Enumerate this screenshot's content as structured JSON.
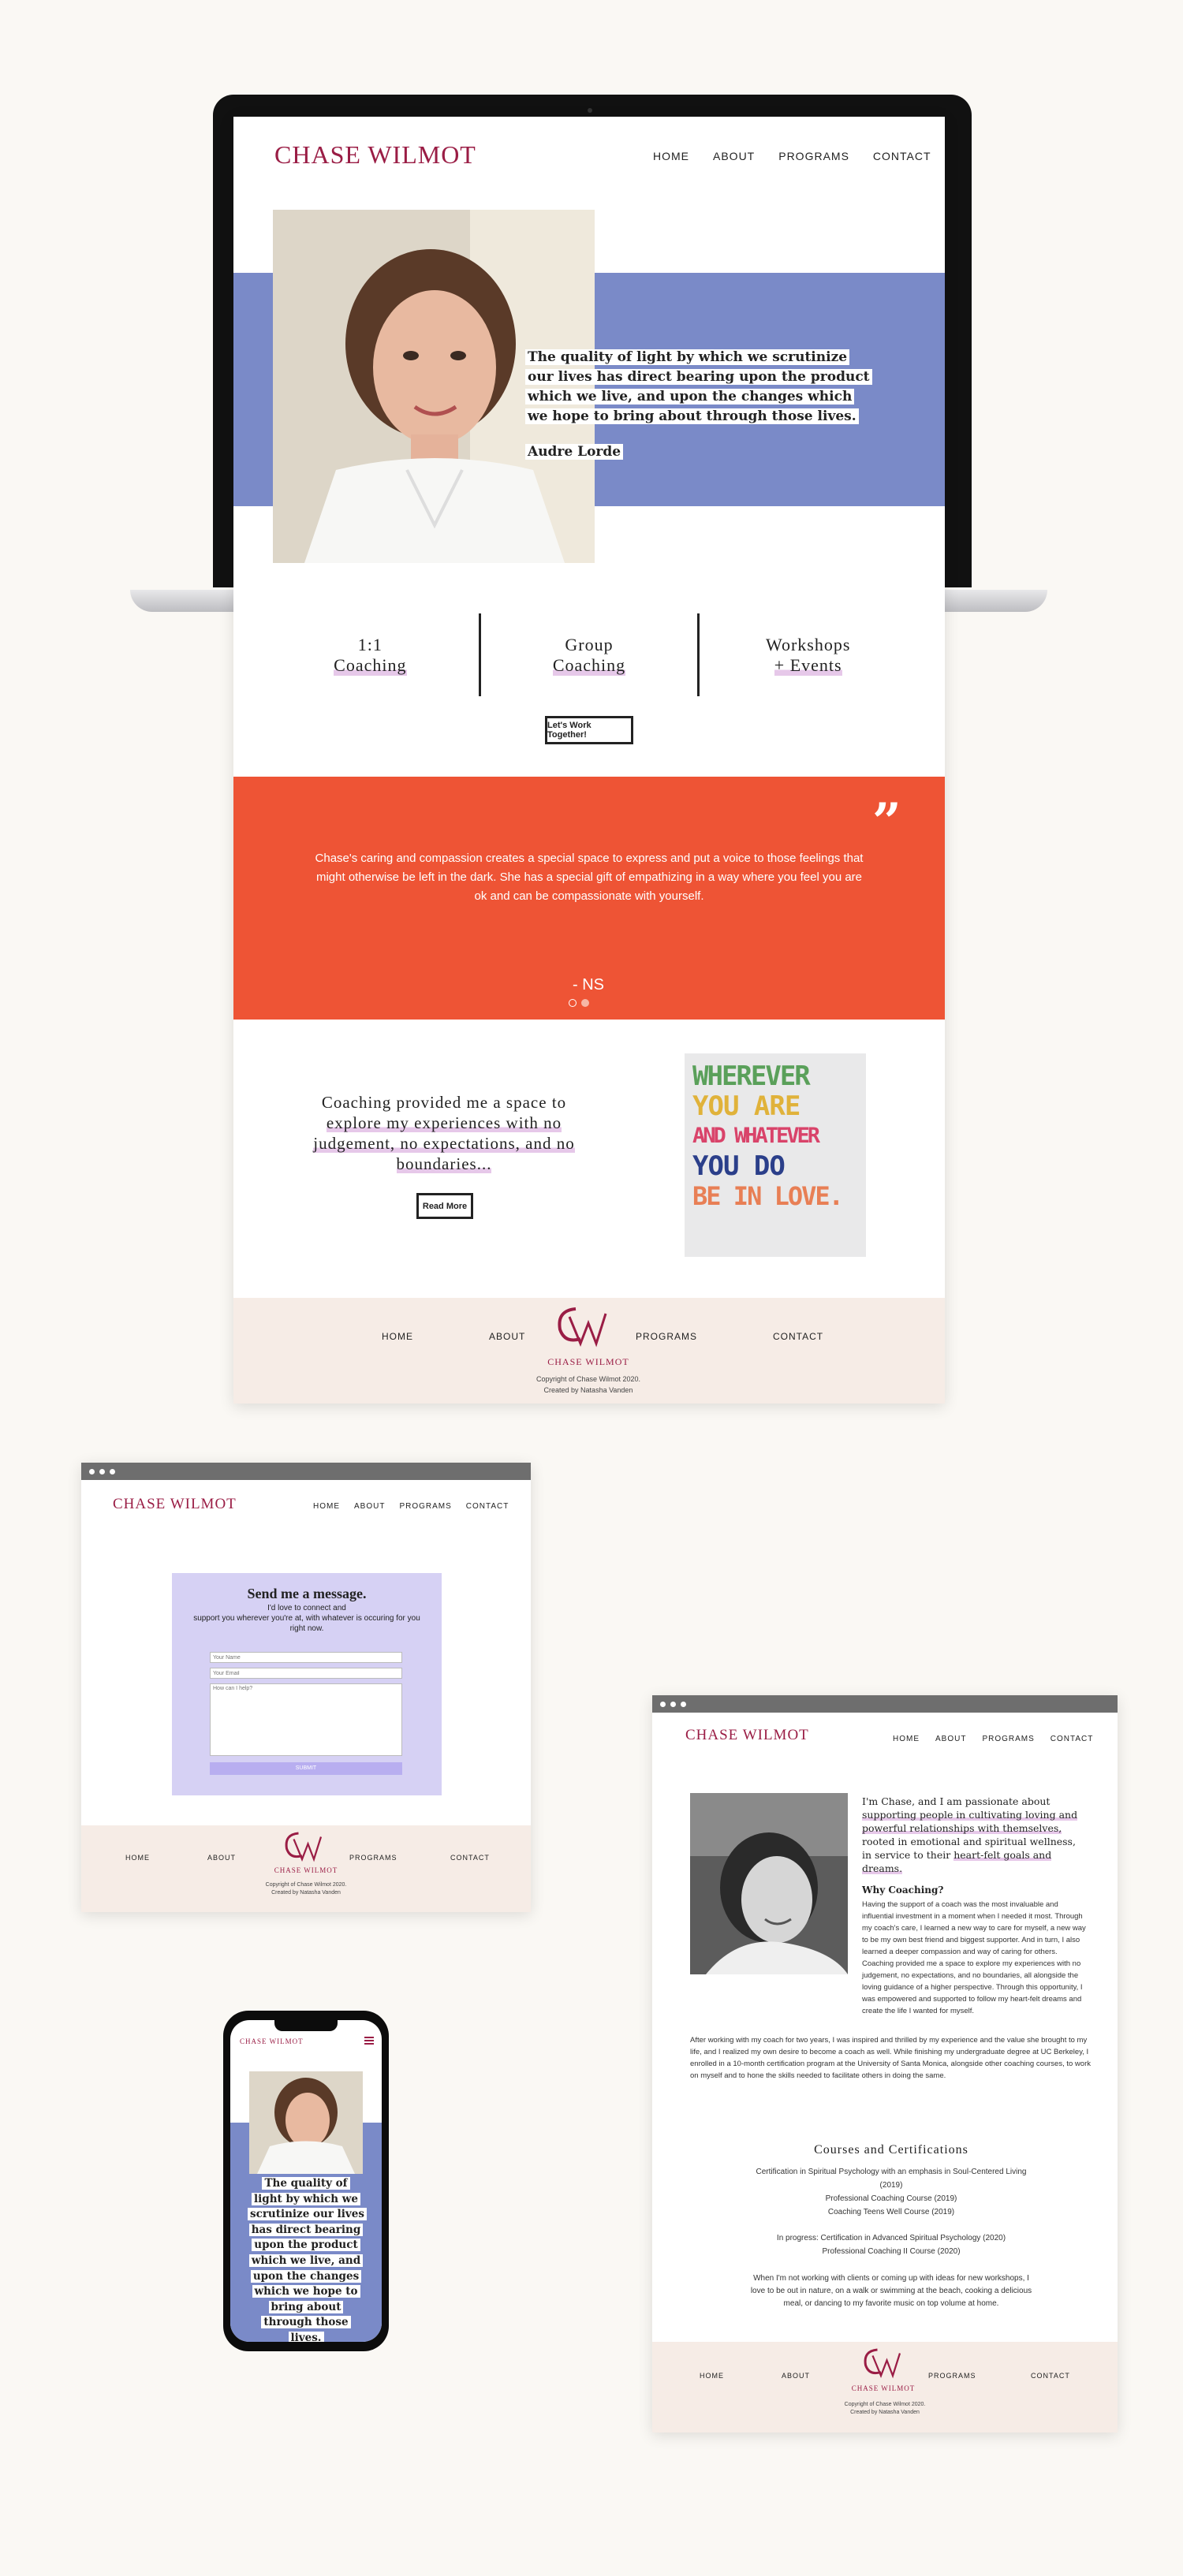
{
  "brand": "CHASE WILMOT",
  "colors": {
    "wine": "#9a1d45",
    "periwinkle": "#7a8ac8",
    "coral": "#ee5435",
    "footer": "#f6ece6",
    "lavender": "#d6d1f4"
  },
  "nav": [
    "HOME",
    "ABOUT",
    "PROGRAMS",
    "CONTACT"
  ],
  "hero": {
    "quote": "The quality of light by which we scrutinize our lives has direct bearing upon the product which we live, and upon the changes which we hope to bring about through those lives.",
    "author": "Audre Lorde"
  },
  "services": [
    {
      "line1": "1:1",
      "line2": "Coaching"
    },
    {
      "line1": "Group",
      "line2": "Coaching"
    },
    {
      "line1": "Workshops",
      "line2": "+ Events"
    }
  ],
  "cta": "Let's Work Together!",
  "testimonial": {
    "text": "Chase's caring and compassion creates a special space to express and put a voice to those feelings that might otherwise be left in the dark. She has a special gift of empathizing in a way where you feel you are ok and can be compassionate with yourself.",
    "attribution": "- NS"
  },
  "coaching_blurb": {
    "line1": "Coaching provided me a space to",
    "line2": "explore my experiences with no",
    "line3": "judgement, no expectations, and no",
    "line4": "boundaries...",
    "button": "Read More"
  },
  "poster": {
    "lines": [
      "WHEREVER",
      "YOU ARE",
      "AND WHATEVER",
      "YOU DO",
      "BE IN LOVE."
    ]
  },
  "footer": {
    "logo_text": "CHASE WILMOT",
    "copyright": "Copyright of Chase Wilmot 2020.",
    "credit": "Created by Natasha Vanden"
  },
  "contact_page": {
    "title": "Send me a message.",
    "sub1": "I'd love to connect and",
    "sub2": "support you wherever you're at, with whatever is occuring for you",
    "sub3": "right now.",
    "name_ph": "Your Name",
    "email_ph": "Your Email",
    "msg_ph": "How can I help?",
    "submit": "SUBMIT"
  },
  "about_page": {
    "intro_plain": "I'm Chase, and I am passionate about",
    "intro_u1": "supporting people in cultivating loving and",
    "intro_u2": "powerful relationships with themselves,",
    "intro_plain2": "rooted in emotional and spiritual wellness,",
    "intro_plain3": "in service to their",
    "intro_u3": "heart-felt goals and",
    "intro_u4": "dreams.",
    "why_title": "Why Coaching?",
    "why_p1": "Having the support of a coach was the most invaluable and influential investment in a moment when I needed it most. Through my coach's care, I learned a new way to care for myself, a new way to be my own best friend and biggest supporter. And in turn, I also learned a deeper compassion and way of caring for others. Coaching provided me a space to explore my experiences with no judgement, no expectations, and no boundaries, all alongside the loving guidance of a higher perspective. Through this opportunity, I was empowered and supported to follow my heart-felt dreams and create the life I wanted for myself.",
    "why_p2": "After working with my coach for two years, I was inspired and thrilled by my experience and the value she brought to my life, and I realized my own desire to become a coach as well. While finishing my undergraduate degree at UC Berkeley, I enrolled in a 10-month certification program at the University of Santa Monica, alongside other coaching courses, to work on myself and to hone the skills needed to facilitate others in doing the same.",
    "courses_title": "Courses and Certifications",
    "courses": [
      "Certification in Spiritual Psychology with an emphasis in Soul-Centered Living",
      "(2019)",
      "Professional Coaching Course (2019)",
      "Coaching Teens Well Course (2019)"
    ],
    "in_progress": [
      "In progress: Certification in Advanced Spiritual Psychology (2020)",
      "Professional Coaching II Course (2020)"
    ],
    "closing": "When I'm not working with clients or coming up with ideas for new workshops, I love to be out in nature, on a walk or swimming at the beach, cooking a delicious meal, or dancing to my favorite music on top volume at home."
  },
  "mobile": {
    "brand": "CHASE WILMOT",
    "quote": "The quality of light by which we scrutinize our lives has direct bearing upon the product which we live, and upon the changes which we hope to bring about through those lives."
  }
}
